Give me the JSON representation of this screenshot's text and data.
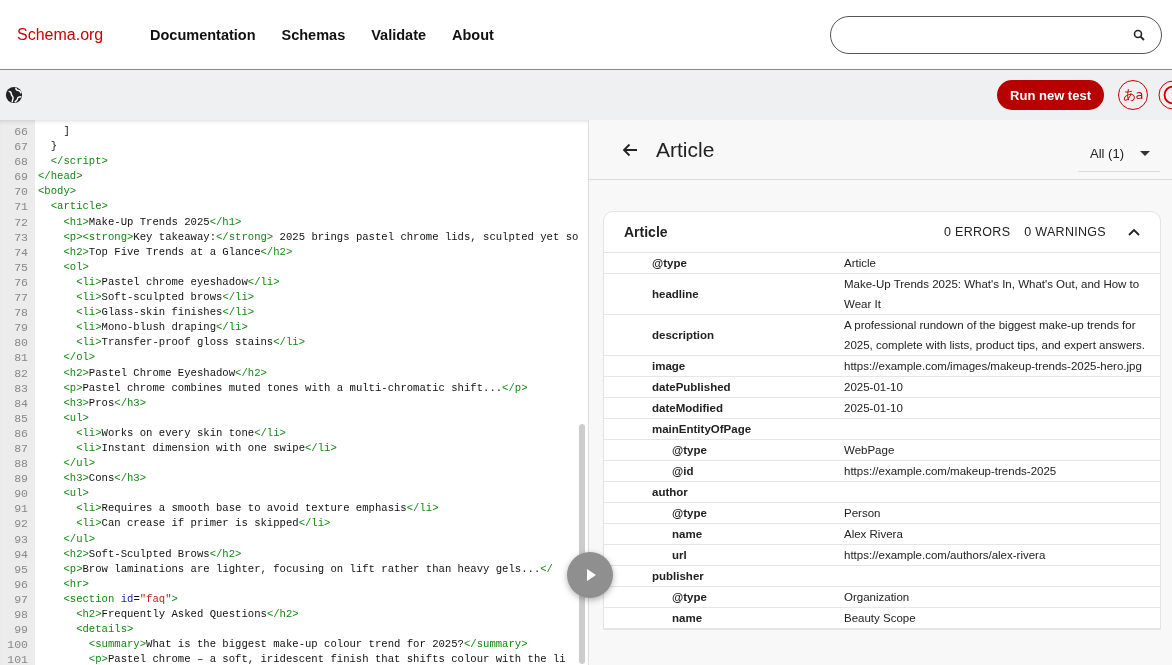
{
  "header": {
    "logo": "Schema.org",
    "nav": [
      "Documentation",
      "Schemas",
      "Validate",
      "About"
    ]
  },
  "toolbar": {
    "run_button": "Run new test",
    "language_button": "あa"
  },
  "code": {
    "lines": [
      {
        "number": "66",
        "tokens": [
          {
            "kind": "text",
            "text": "    ]"
          }
        ]
      },
      {
        "number": "67",
        "tokens": [
          {
            "kind": "text",
            "text": "  }"
          }
        ]
      },
      {
        "number": "68",
        "tokens": [
          {
            "kind": "tag",
            "text": "  </script>"
          }
        ]
      },
      {
        "number": "69",
        "tokens": [
          {
            "kind": "tag",
            "text": "</head>"
          }
        ]
      },
      {
        "number": "70",
        "tokens": [
          {
            "kind": "tag",
            "text": "<body>"
          }
        ]
      },
      {
        "number": "71",
        "tokens": [
          {
            "kind": "tag",
            "text": "  <article>"
          }
        ]
      },
      {
        "number": "72",
        "tokens": [
          {
            "kind": "tag",
            "text": "    <h1>"
          },
          {
            "kind": "text",
            "text": "Make-Up Trends 2025"
          },
          {
            "kind": "tag",
            "text": "</h1>"
          }
        ]
      },
      {
        "number": "73",
        "tokens": [
          {
            "kind": "tag",
            "text": "    <p><strong>"
          },
          {
            "kind": "text",
            "text": "Key takeaway:"
          },
          {
            "kind": "tag",
            "text": "</strong>"
          },
          {
            "kind": "text",
            "text": " 2025 brings pastel chrome lids, sculpted yet so"
          }
        ]
      },
      {
        "number": "74",
        "tokens": [
          {
            "kind": "tag",
            "text": "    <h2>"
          },
          {
            "kind": "text",
            "text": "Top Five Trends at a Glance"
          },
          {
            "kind": "tag",
            "text": "</h2>"
          }
        ]
      },
      {
        "number": "75",
        "tokens": [
          {
            "kind": "tag",
            "text": "    <ol>"
          }
        ]
      },
      {
        "number": "76",
        "tokens": [
          {
            "kind": "tag",
            "text": "      <li>"
          },
          {
            "kind": "text",
            "text": "Pastel chrome eyeshadow"
          },
          {
            "kind": "tag",
            "text": "</li>"
          }
        ]
      },
      {
        "number": "77",
        "tokens": [
          {
            "kind": "tag",
            "text": "      <li>"
          },
          {
            "kind": "text",
            "text": "Soft-sculpted brows"
          },
          {
            "kind": "tag",
            "text": "</li>"
          }
        ]
      },
      {
        "number": "78",
        "tokens": [
          {
            "kind": "tag",
            "text": "      <li>"
          },
          {
            "kind": "text",
            "text": "Glass-skin finishes"
          },
          {
            "kind": "tag",
            "text": "</li>"
          }
        ]
      },
      {
        "number": "79",
        "tokens": [
          {
            "kind": "tag",
            "text": "      <li>"
          },
          {
            "kind": "text",
            "text": "Mono-blush draping"
          },
          {
            "kind": "tag",
            "text": "</li>"
          }
        ]
      },
      {
        "number": "80",
        "tokens": [
          {
            "kind": "tag",
            "text": "      <li>"
          },
          {
            "kind": "text",
            "text": "Transfer-proof gloss stains"
          },
          {
            "kind": "tag",
            "text": "</li>"
          }
        ]
      },
      {
        "number": "81",
        "tokens": [
          {
            "kind": "tag",
            "text": "    </ol>"
          }
        ]
      },
      {
        "number": "82",
        "tokens": [
          {
            "kind": "tag",
            "text": "    <h2>"
          },
          {
            "kind": "text",
            "text": "Pastel Chrome Eyeshadow"
          },
          {
            "kind": "tag",
            "text": "</h2>"
          }
        ]
      },
      {
        "number": "83",
        "tokens": [
          {
            "kind": "tag",
            "text": "    <p>"
          },
          {
            "kind": "text",
            "text": "Pastel chrome combines muted tones with a multi-chromatic shift..."
          },
          {
            "kind": "tag",
            "text": "</p>"
          }
        ]
      },
      {
        "number": "84",
        "tokens": [
          {
            "kind": "tag",
            "text": "    <h3>"
          },
          {
            "kind": "text",
            "text": "Pros"
          },
          {
            "kind": "tag",
            "text": "</h3>"
          }
        ]
      },
      {
        "number": "85",
        "tokens": [
          {
            "kind": "tag",
            "text": "    <ul>"
          }
        ]
      },
      {
        "number": "86",
        "tokens": [
          {
            "kind": "tag",
            "text": "      <li>"
          },
          {
            "kind": "text",
            "text": "Works on every skin tone"
          },
          {
            "kind": "tag",
            "text": "</li>"
          }
        ]
      },
      {
        "number": "87",
        "tokens": [
          {
            "kind": "tag",
            "text": "      <li>"
          },
          {
            "kind": "text",
            "text": "Instant dimension with one swipe"
          },
          {
            "kind": "tag",
            "text": "</li>"
          }
        ]
      },
      {
        "number": "88",
        "tokens": [
          {
            "kind": "tag",
            "text": "    </ul>"
          }
        ]
      },
      {
        "number": "89",
        "tokens": [
          {
            "kind": "tag",
            "text": "    <h3>"
          },
          {
            "kind": "text",
            "text": "Cons"
          },
          {
            "kind": "tag",
            "text": "</h3>"
          }
        ]
      },
      {
        "number": "90",
        "tokens": [
          {
            "kind": "tag",
            "text": "    <ul>"
          }
        ]
      },
      {
        "number": "91",
        "tokens": [
          {
            "kind": "tag",
            "text": "      <li>"
          },
          {
            "kind": "text",
            "text": "Requires a smooth base to avoid texture emphasis"
          },
          {
            "kind": "tag",
            "text": "</li>"
          }
        ]
      },
      {
        "number": "92",
        "tokens": [
          {
            "kind": "tag",
            "text": "      <li>"
          },
          {
            "kind": "text",
            "text": "Can crease if primer is skipped"
          },
          {
            "kind": "tag",
            "text": "</li>"
          }
        ]
      },
      {
        "number": "93",
        "tokens": [
          {
            "kind": "tag",
            "text": "    </ul>"
          }
        ]
      },
      {
        "number": "94",
        "tokens": [
          {
            "kind": "tag",
            "text": "    <h2>"
          },
          {
            "kind": "text",
            "text": "Soft-Sculpted Brows"
          },
          {
            "kind": "tag",
            "text": "</h2>"
          }
        ]
      },
      {
        "number": "95",
        "tokens": [
          {
            "kind": "tag",
            "text": "    <p>"
          },
          {
            "kind": "text",
            "text": "Brow laminations are lighter, focusing on lift rather than heavy gels..."
          },
          {
            "kind": "tag",
            "text": "</"
          }
        ]
      },
      {
        "number": "96",
        "tokens": [
          {
            "kind": "tag",
            "text": "    <hr>"
          }
        ]
      },
      {
        "number": "97",
        "tokens": [
          {
            "kind": "tag",
            "text": "    <section "
          },
          {
            "kind": "attr",
            "text": "id"
          },
          {
            "kind": "text",
            "text": "="
          },
          {
            "kind": "string",
            "text": "\"faq\""
          },
          {
            "kind": "tag",
            "text": ">"
          }
        ]
      },
      {
        "number": "98",
        "tokens": [
          {
            "kind": "tag",
            "text": "      <h2>"
          },
          {
            "kind": "text",
            "text": "Frequently Asked Questions"
          },
          {
            "kind": "tag",
            "text": "</h2>"
          }
        ]
      },
      {
        "number": "99",
        "tokens": [
          {
            "kind": "tag",
            "text": "      <details>"
          }
        ]
      },
      {
        "number": "100",
        "tokens": [
          {
            "kind": "tag",
            "text": "        <summary>"
          },
          {
            "kind": "text",
            "text": "What is the biggest make-up colour trend for 2025?"
          },
          {
            "kind": "tag",
            "text": "</summary>"
          }
        ]
      },
      {
        "number": "101",
        "tokens": [
          {
            "kind": "tag",
            "text": "        <p>"
          },
          {
            "kind": "text",
            "text": "Pastel chrome – a soft, iridescent finish that shifts colour with the li"
          }
        ]
      }
    ]
  },
  "result": {
    "title": "Article",
    "filter": "All (1)",
    "card": {
      "title": "Article",
      "errors": "0 ERRORS",
      "warnings": "0 WARNINGS",
      "expanded": true,
      "rows": [
        {
          "key": "@type",
          "value": "Article"
        },
        {
          "key": "headline",
          "value": "Make-Up Trends 2025: What's In, What's Out, and How to Wear It"
        },
        {
          "key": "description",
          "value": "A professional rundown of the biggest make-up trends for 2025, complete with lists, product tips, and expert answers."
        },
        {
          "key": "image",
          "value": "https://example.com/images/makeup-trends-2025-hero.jpg"
        },
        {
          "key": "datePublished",
          "value": "2025-01-10"
        },
        {
          "key": "dateModified",
          "value": "2025-01-10"
        },
        {
          "key": "mainEntityOfPage",
          "children": [
            {
              "key": "@type",
              "value": "WebPage"
            },
            {
              "key": "@id",
              "value": "https://example.com/makeup-trends-2025"
            }
          ]
        },
        {
          "key": "author",
          "children": [
            {
              "key": "@type",
              "value": "Person"
            },
            {
              "key": "name",
              "value": "Alex Rivera"
            },
            {
              "key": "url",
              "value": "https://example.com/authors/alex-rivera"
            }
          ]
        },
        {
          "key": "publisher",
          "children": [
            {
              "key": "@type",
              "value": "Organization"
            },
            {
              "key": "name",
              "value": "Beauty Scope"
            }
          ]
        }
      ]
    }
  }
}
